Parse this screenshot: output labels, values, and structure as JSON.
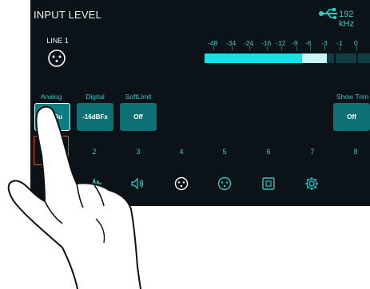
{
  "header": {
    "title": "INPUT LEVEL",
    "usb_icon": "usb-icon",
    "sample_rate": "192 kHz"
  },
  "channel": {
    "name": "LINE 1",
    "connector_icon": "xlr-connector-icon"
  },
  "meter": {
    "scale": [
      "-48",
      "-34",
      "-24",
      "-16",
      "-12",
      "-9",
      "-6",
      "-3",
      "-1",
      "0"
    ],
    "level_fraction": 0.59,
    "peak_fraction": 0.74,
    "colors": {
      "fill": "#12e3e6",
      "peak": "#c6f6f7",
      "track": "#0f3f42"
    }
  },
  "controls": {
    "analog": {
      "label": "Analog",
      "value": "+4dBu"
    },
    "digital": {
      "label": "Digital",
      "value": "-16dBFs"
    },
    "softlimit": {
      "label": "SoftLimit",
      "value": "Off"
    },
    "showtrim": {
      "label": "Show Trim",
      "value": "Off"
    }
  },
  "channels": [
    "1",
    "2",
    "3",
    "4",
    "5",
    "6",
    "7",
    "8"
  ],
  "nav": [
    "waveform-icon",
    "speaker-icon",
    "xlr-connector-icon",
    "xlr-output-icon",
    "square-icon",
    "gear-icon"
  ],
  "accent": "#2ad2c4",
  "selected_channel_color": "#d9502a"
}
